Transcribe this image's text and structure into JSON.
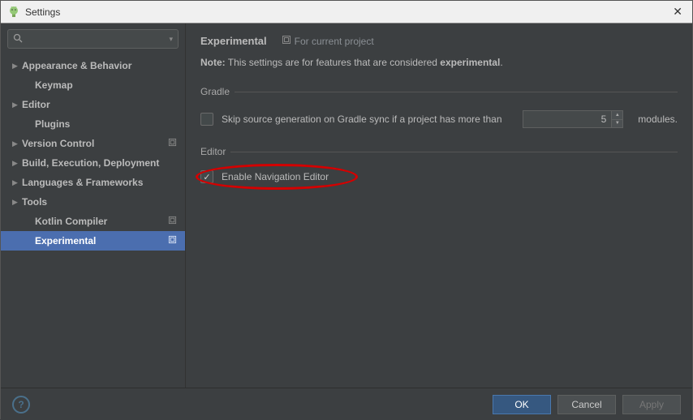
{
  "window": {
    "title": "Settings"
  },
  "search": {
    "placeholder": ""
  },
  "sidebar": {
    "items": [
      {
        "label": "Appearance & Behavior",
        "expandable": true,
        "child": false,
        "proj": false,
        "selected": false
      },
      {
        "label": "Keymap",
        "expandable": false,
        "child": true,
        "proj": false,
        "selected": false
      },
      {
        "label": "Editor",
        "expandable": true,
        "child": false,
        "proj": false,
        "selected": false
      },
      {
        "label": "Plugins",
        "expandable": false,
        "child": true,
        "proj": false,
        "selected": false
      },
      {
        "label": "Version Control",
        "expandable": true,
        "child": false,
        "proj": true,
        "selected": false
      },
      {
        "label": "Build, Execution, Deployment",
        "expandable": true,
        "child": false,
        "proj": false,
        "selected": false
      },
      {
        "label": "Languages & Frameworks",
        "expandable": true,
        "child": false,
        "proj": false,
        "selected": false
      },
      {
        "label": "Tools",
        "expandable": true,
        "child": false,
        "proj": false,
        "selected": false
      },
      {
        "label": "Kotlin Compiler",
        "expandable": false,
        "child": true,
        "proj": true,
        "selected": false
      },
      {
        "label": "Experimental",
        "expandable": false,
        "child": true,
        "proj": true,
        "selected": true
      }
    ]
  },
  "main": {
    "title": "Experimental",
    "scope": "For current project",
    "note_prefix": "Note:",
    "note_body": " This settings are for features that are considered ",
    "note_bold": "experimental",
    "note_suffix": ".",
    "gradle": {
      "legend": "Gradle",
      "skip_label": "Skip source generation on Gradle sync if a project has more than",
      "module_count": "5",
      "suffix": "modules."
    },
    "editor": {
      "legend": "Editor",
      "nav_label": "Enable Navigation Editor"
    }
  },
  "footer": {
    "ok": "OK",
    "cancel": "Cancel",
    "apply": "Apply"
  }
}
